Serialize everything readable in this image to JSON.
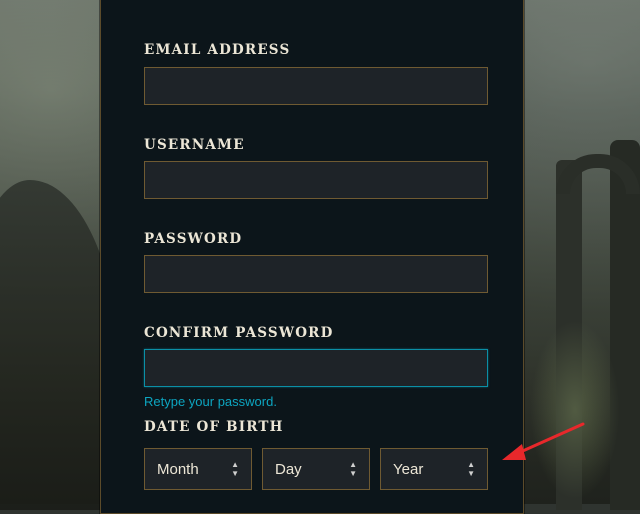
{
  "form": {
    "email": {
      "label": "EMAIL ADDRESS",
      "value": ""
    },
    "username": {
      "label": "USERNAME",
      "value": ""
    },
    "password": {
      "label": "PASSWORD",
      "value": ""
    },
    "confirm_password": {
      "label": "CONFIRM PASSWORD",
      "value": "",
      "hint": "Retype your password."
    },
    "date_of_birth": {
      "label": "DATE OF BIRTH",
      "month": "Month",
      "day": "Day",
      "year": "Year"
    }
  },
  "colors": {
    "panel_bg": "#0c151a",
    "input_border": "#6f5a32",
    "focus_border": "#0b8fa6",
    "hint_text": "#0da5c0",
    "annotation_arrow": "#e8282b"
  },
  "icons": {
    "select_caret": "up-down-caret-icon",
    "annotation": "red-arrow-icon"
  }
}
